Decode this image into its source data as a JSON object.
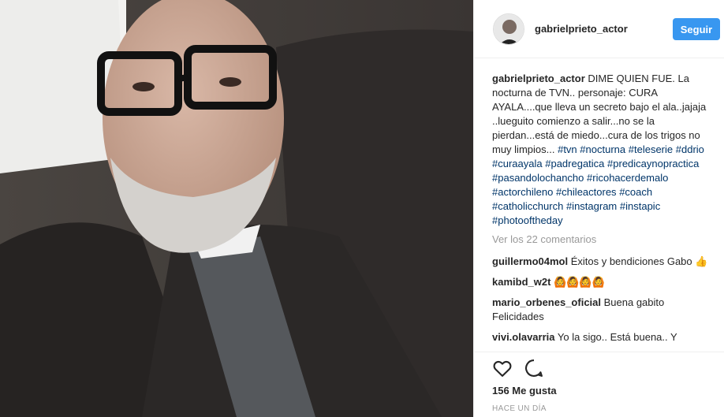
{
  "post": {
    "username": "gabrielprieto_actor",
    "follow_label": "Seguir",
    "caption_user": "gabrielprieto_actor",
    "caption_text": "DIME QUIEN FUE. La nocturna de TVN.. personaje: CURA AYALA....que lleva un secreto bajo el ala..jajaja ..lueguito comienzo a salir...no se la pierdan...está de miedo...cura de los trigos no muy limpios...",
    "hashtags": [
      "#tvn",
      "#nocturna",
      "#teleserie",
      "#ddrio",
      "#curaayala",
      "#padregatica",
      "#predicaynopractica",
      "#pasandolochancho",
      "#ricohacerdemalo",
      "#actorchileno",
      "#chileactores",
      "#coach",
      "#catholicchurch",
      "#instagram",
      "#instapic",
      "#photooftheday"
    ],
    "view_comments": "Ver los 22 comentarios",
    "comments": [
      {
        "user": "guillermo04mol",
        "text": "Éxitos y bendiciones Gabo 👍"
      },
      {
        "user": "kamibd_w2t",
        "text": "🙆🙆🙆🙆"
      },
      {
        "user": "mario_orbenes_oficial",
        "text": "Buena gabito Felicidades"
      },
      {
        "user": "vivi.olavarria",
        "text": "Yo la sigo.. Está buena.. Y"
      }
    ],
    "likes": "156 Me gusta",
    "time": "HACE UN DÍA"
  },
  "icons": {
    "like": "heart-icon",
    "comment": "comment-icon"
  },
  "colors": {
    "follow_button": "#3897f0",
    "hashtag": "#003569",
    "muted": "#999999"
  }
}
